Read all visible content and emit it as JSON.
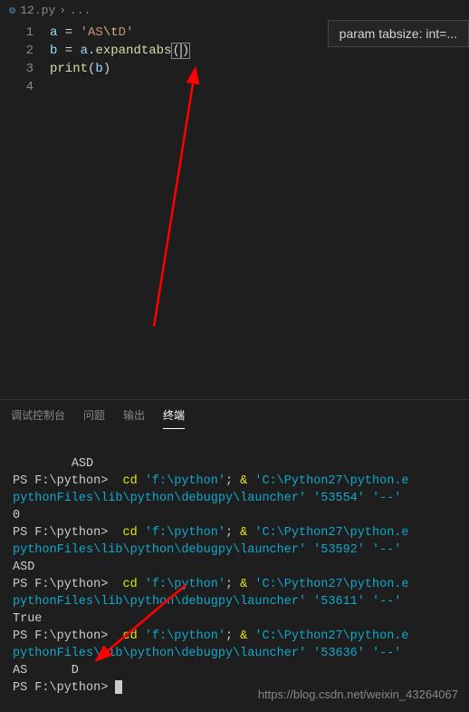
{
  "breadcrumb": {
    "filename": "12.py",
    "more": "..."
  },
  "editor": {
    "lines": [
      "1",
      "2",
      "3",
      "4"
    ],
    "code": {
      "l1_var": "a",
      "l1_eq": " = ",
      "l1_str_q1": "'",
      "l1_str_p1": "AS",
      "l1_str_esc": "\\t",
      "l1_str_p2": "D",
      "l1_str_q2": "'",
      "l2_var": "b",
      "l2_eq": " = ",
      "l2_obj": "a",
      "l2_dot": ".",
      "l2_meth": "expandtabs",
      "l2_paren_o": "(",
      "l2_paren_c": ")",
      "l3_fn": "print",
      "l3_po": "(",
      "l3_arg": "b",
      "l3_pc": ")"
    },
    "param_hint": "param tabsize: int=..."
  },
  "panel": {
    "tabs": {
      "debug_console": "调试控制台",
      "problems": "问题",
      "output": "输出",
      "terminal": "终端"
    }
  },
  "terminal": {
    "out0": "        ASD",
    "ps": "PS F:\\python> ",
    "cmd_cd": " cd",
    "path1": " 'f:\\python'",
    "sep": "; ",
    "amp": "&",
    "exe_py": " 'C:\\Python27\\python.e",
    "exe_line2a": "pythonFiles\\lib\\python\\debugpy\\launcher'",
    "port1": " '53554'",
    "tail": " '--'",
    "out1": "0",
    "port2": " '53592'",
    "out2": "ASD",
    "port3": " '53611'",
    "out3": "True",
    "port4": " '53636'",
    "out4": "AS      D",
    "exe_line2b_pre": "pythonFiles\\lib",
    "exe_line2b_mid": "\\py",
    "exe_line2b_post": "thon\\debugpy\\launcher'"
  },
  "watermark": "https://blog.csdn.net/weixin_43264067"
}
